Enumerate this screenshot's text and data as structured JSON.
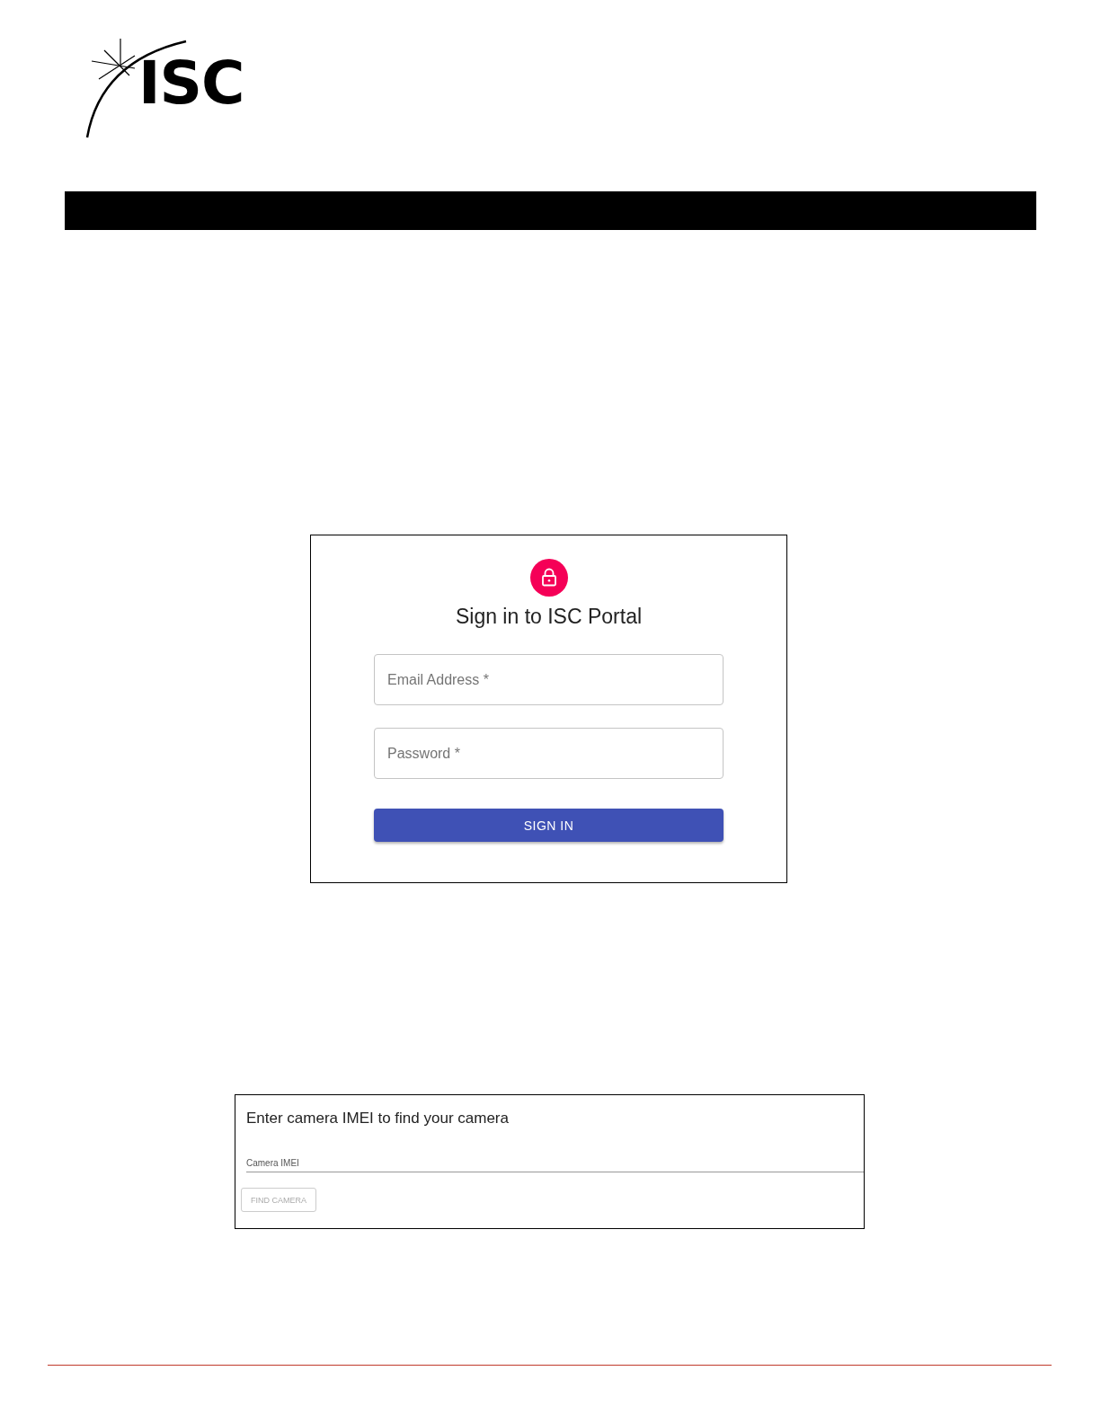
{
  "logo": {
    "text": "ISC"
  },
  "login": {
    "title": "Sign in to ISC Portal",
    "fields": [
      {
        "placeholder": "Email Address *"
      },
      {
        "placeholder": "Password *"
      }
    ],
    "button": {
      "label": "SIGN IN"
    }
  },
  "camera_lookup": {
    "title": "Enter camera IMEI to find your camera",
    "field": {
      "placeholder": "Camera IMEI"
    },
    "button": {
      "label": "FIND CAMERA",
      "disabled": true
    }
  }
}
